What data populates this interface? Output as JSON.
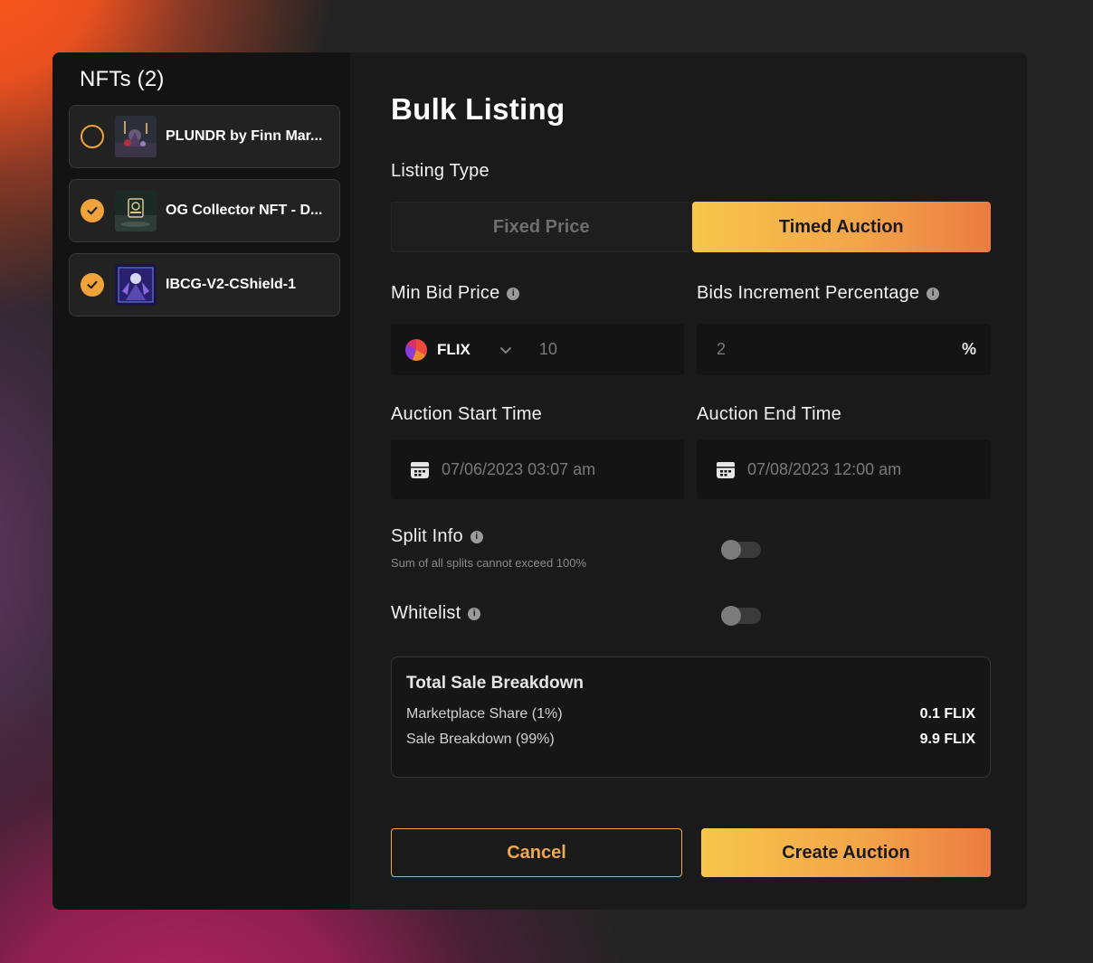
{
  "sidebar": {
    "title": "NFTs (2)",
    "items": [
      {
        "name": "PLUNDR by Finn Mar...",
        "selected": false
      },
      {
        "name": "OG Collector NFT - D...",
        "selected": true
      },
      {
        "name": "IBCG-V2-CShield-1",
        "selected": true
      }
    ]
  },
  "main": {
    "title": "Bulk Listing",
    "listing_type_label": "Listing Type",
    "tabs": [
      {
        "label": "Fixed Price",
        "active": false
      },
      {
        "label": "Timed Auction",
        "active": true
      }
    ],
    "min_bid": {
      "label": "Min Bid Price",
      "token": "FLIX",
      "placeholder": "10"
    },
    "bids_increment": {
      "label": "Bids Increment Percentage",
      "placeholder": "2",
      "unit": "%"
    },
    "start_time": {
      "label": "Auction Start Time",
      "value": "07/06/2023 03:07 am"
    },
    "end_time": {
      "label": "Auction End Time",
      "value": "07/08/2023 12:00 am"
    },
    "split_info": {
      "label": "Split Info",
      "hint": "Sum of all splits cannot exceed 100%",
      "enabled": false
    },
    "whitelist": {
      "label": "Whitelist",
      "enabled": false
    },
    "info_glyph": "i",
    "breakdown": {
      "title": "Total Sale Breakdown",
      "rows": [
        {
          "label": "Marketplace Share (1%)",
          "value": "0.1 FLIX"
        },
        {
          "label": "Sale Breakdown (99%)",
          "value": "9.9 FLIX"
        }
      ]
    },
    "cancel_label": "Cancel",
    "create_label": "Create Auction"
  },
  "colors": {
    "accent": "#f0a33a",
    "gradient_start": "#f7c64a",
    "gradient_end": "#ec7b43"
  }
}
